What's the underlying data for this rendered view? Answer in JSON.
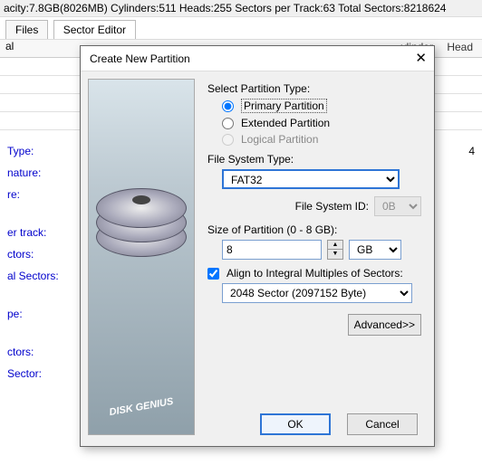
{
  "topbar": "acity:7.8GB(8026MB) Cylinders:511 Heads:255 Sectors per Track:63 Total Sectors:8218624",
  "tabs": {
    "files": "Files",
    "sector_editor": "Sector Editor"
  },
  "bg_header": {
    "col_label": "al",
    "col_cyl": "ylinder",
    "col_head": "Head"
  },
  "bg_info": {
    "type": "Type:",
    "nature": "nature:",
    "re": "re:",
    "per_track": "er track:",
    "ctors": "ctors:",
    "al_sectors": "al Sectors:",
    "pe": "pe:",
    "sctors": "ctors:",
    "sector": "Sector:",
    "val4": "4"
  },
  "dialog": {
    "title": "Create New Partition",
    "select_type": "Select Partition Type:",
    "primary": "Primary Partition",
    "extended": "Extended Partition",
    "logical": "Logical Partition",
    "fs_type": "File System Type:",
    "fat32": "FAT32",
    "fs_id_label": "File System ID:",
    "fs_id": "0B",
    "size_label": "Size of Partition (0 - 8 GB):",
    "size_value": "8",
    "size_unit": "GB",
    "align_label": "Align to Integral Multiples of Sectors:",
    "align_value": "2048 Sector (2097152 Byte)",
    "advanced": "Advanced>>",
    "ok": "OK",
    "cancel": "Cancel",
    "brand": "DISK GENIUS"
  }
}
